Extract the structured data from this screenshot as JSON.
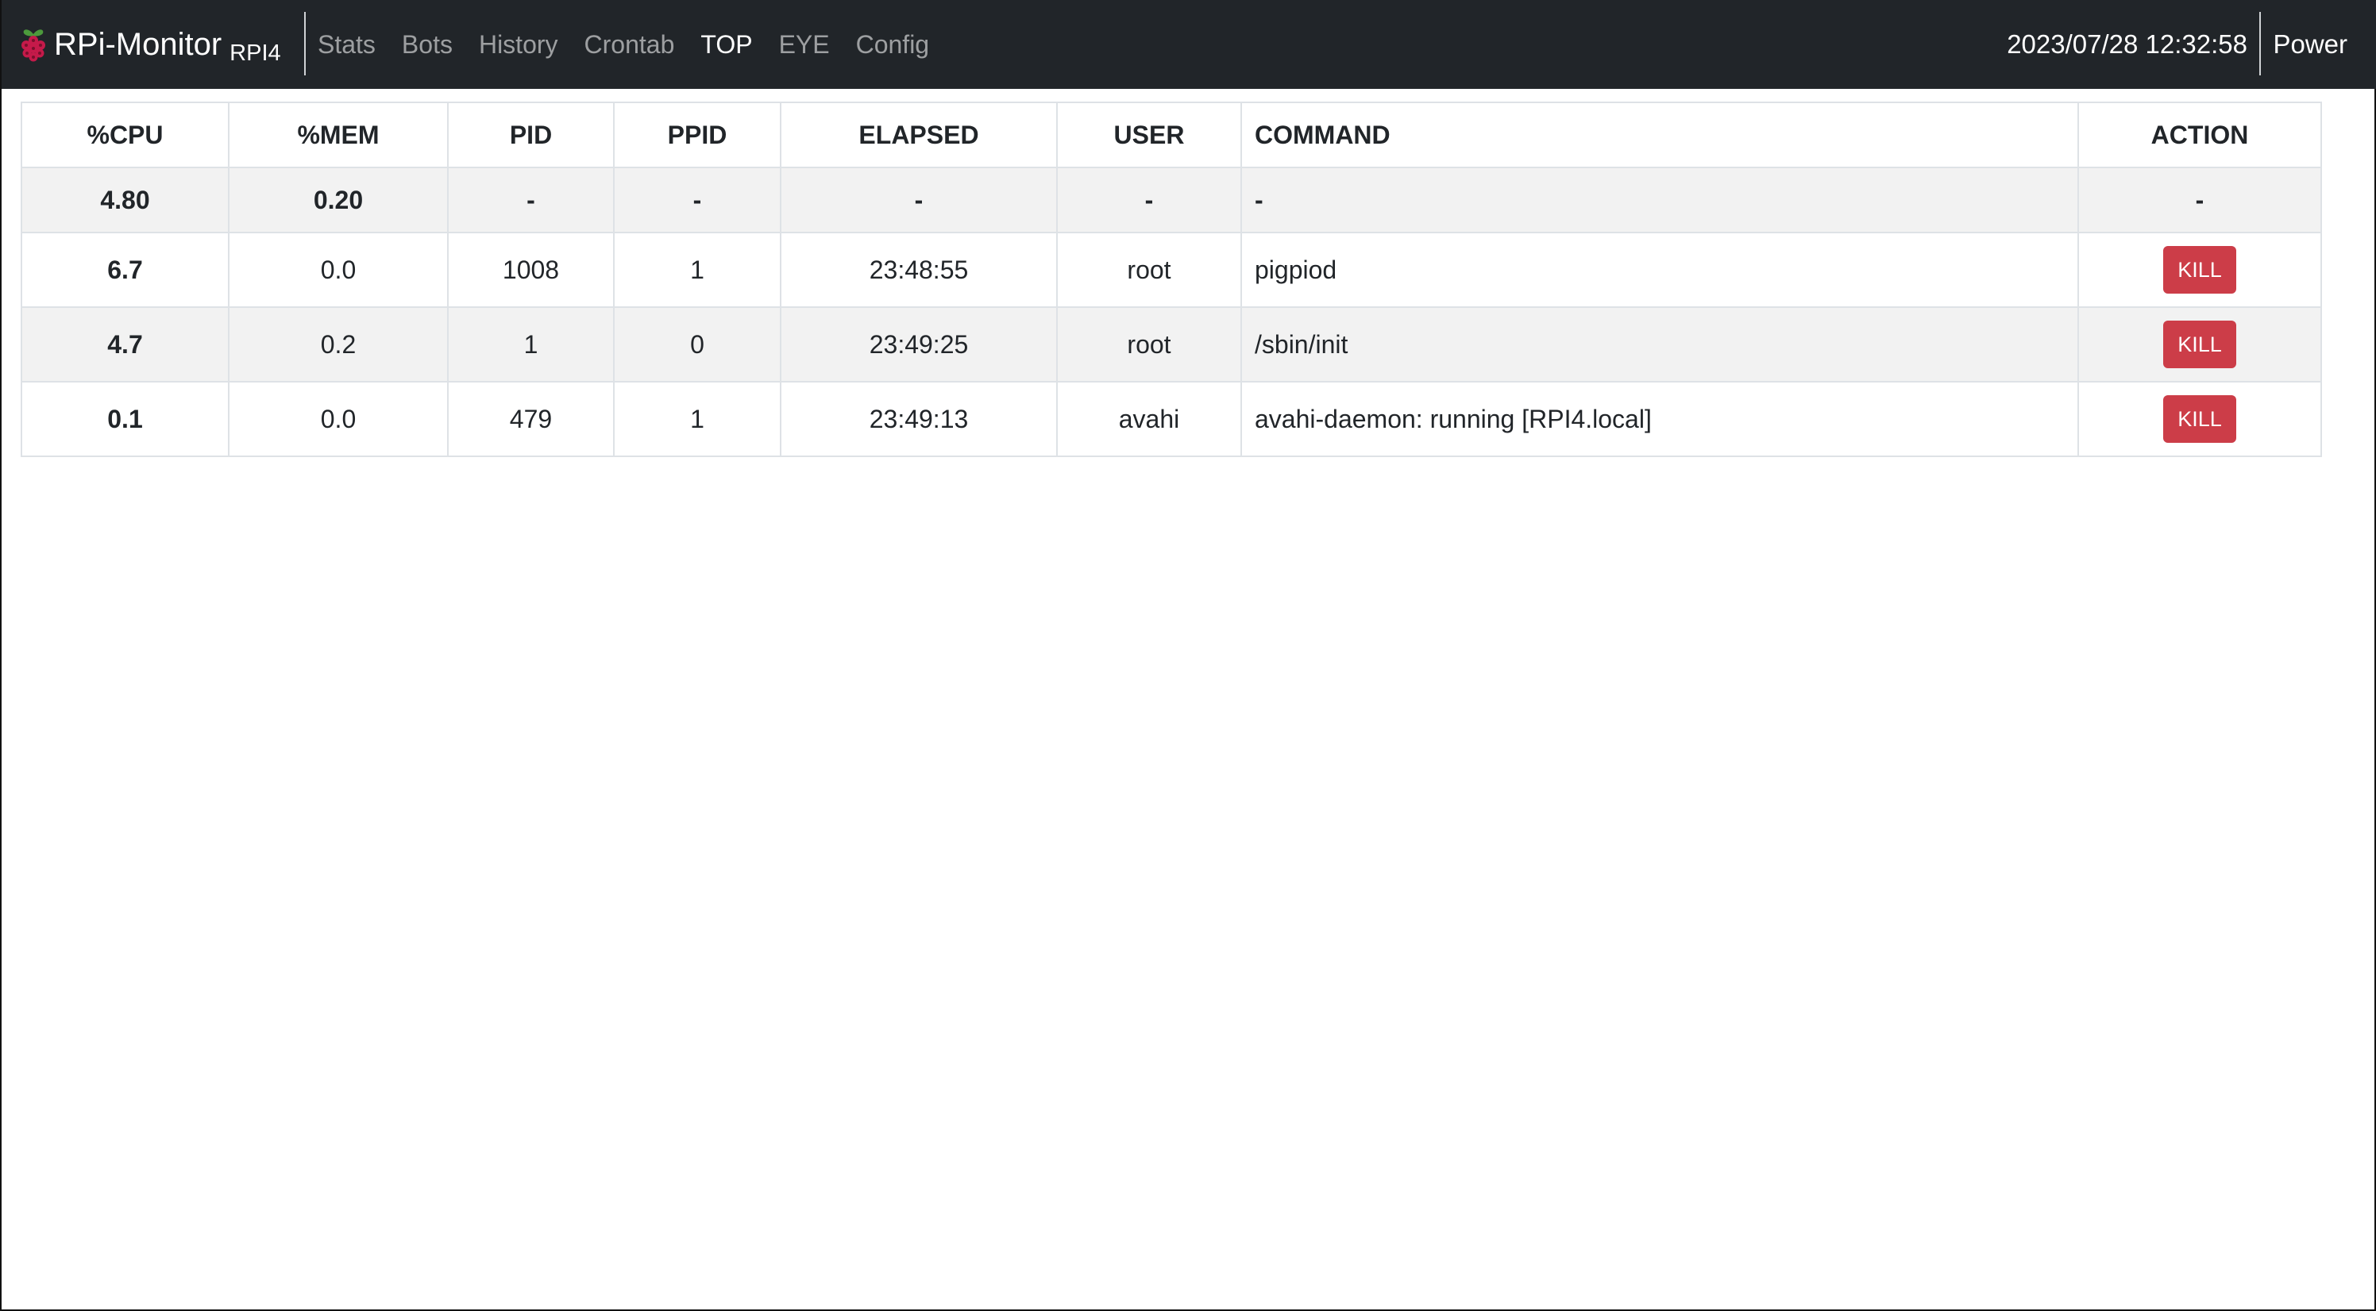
{
  "navbar": {
    "brand_name": "RPi-Monitor",
    "brand_host": "RPI4",
    "links": [
      {
        "label": "Stats",
        "active": false
      },
      {
        "label": "Bots",
        "active": false
      },
      {
        "label": "History",
        "active": false
      },
      {
        "label": "Crontab",
        "active": false
      },
      {
        "label": "TOP",
        "active": true
      },
      {
        "label": "EYE",
        "active": false
      },
      {
        "label": "Config",
        "active": false
      }
    ],
    "datetime": "2023/07/28 12:32:58",
    "power_label": "Power"
  },
  "table": {
    "headers": {
      "cpu": "%CPU",
      "mem": "%MEM",
      "pid": "PID",
      "ppid": "PPID",
      "elapsed": "ELAPSED",
      "user": "USER",
      "command": "COMMAND",
      "action": "ACTION"
    },
    "summary": {
      "cpu": "4.80",
      "mem": "0.20",
      "pid": "-",
      "ppid": "-",
      "elapsed": "-",
      "user": "-",
      "command": "-",
      "action": "-"
    },
    "rows": [
      {
        "cpu": "6.7",
        "mem": "0.0",
        "pid": "1008",
        "ppid": "1",
        "elapsed": "23:48:55",
        "user": "root",
        "command": "pigpiod",
        "action_label": "KILL"
      },
      {
        "cpu": "4.7",
        "mem": "0.2",
        "pid": "1",
        "ppid": "0",
        "elapsed": "23:49:25",
        "user": "root",
        "command": "/sbin/init",
        "action_label": "KILL"
      },
      {
        "cpu": "0.1",
        "mem": "0.0",
        "pid": "479",
        "ppid": "1",
        "elapsed": "23:49:13",
        "user": "avahi",
        "command": "avahi-daemon: running [RPI4.local]",
        "action_label": "KILL"
      }
    ]
  },
  "colors": {
    "navbar_bg": "#212529",
    "kill_button": "#cc3d48",
    "striped_row": "#f2f2f2"
  },
  "icons": {
    "brand": "raspberry-icon"
  }
}
